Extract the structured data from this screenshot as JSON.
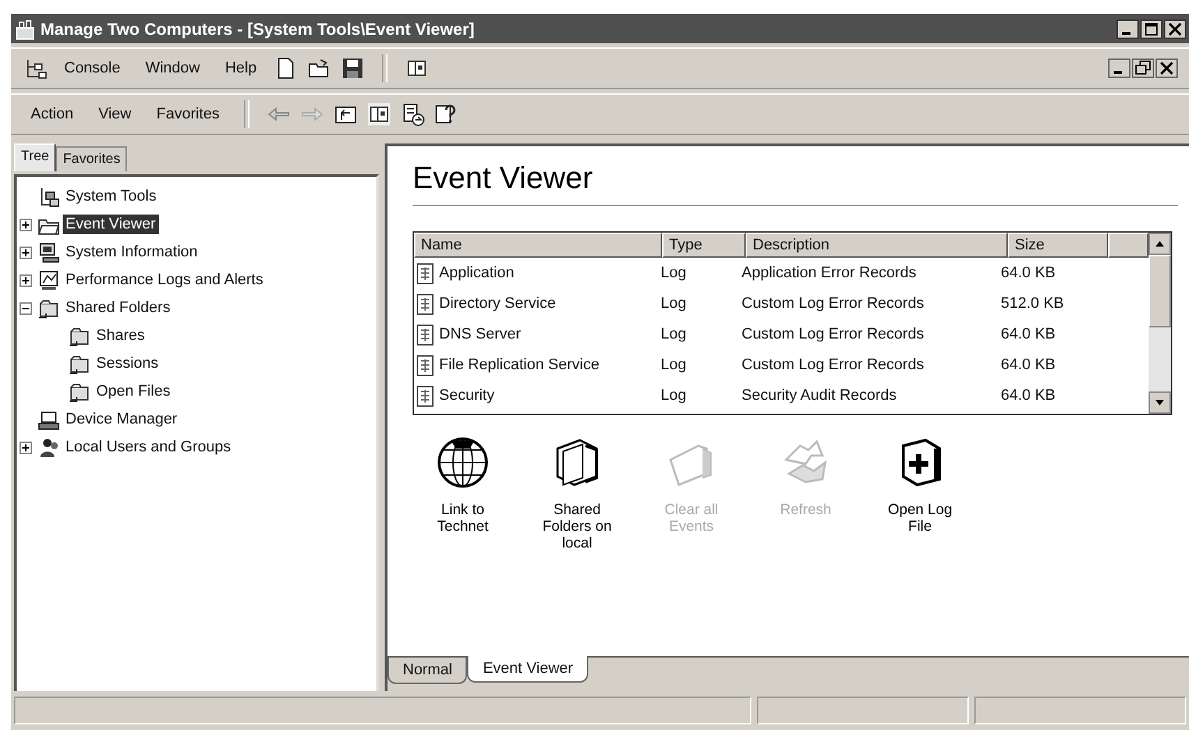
{
  "window": {
    "title": "Manage Two Computers - [System Tools\\Event Viewer]"
  },
  "menu_bar": {
    "items": [
      "Console",
      "Window",
      "Help"
    ]
  },
  "action_bar": {
    "items": [
      "Action",
      "View",
      "Favorites"
    ]
  },
  "left_tabs": [
    {
      "label": "Tree",
      "selected": true
    },
    {
      "label": "Favorites",
      "selected": false
    }
  ],
  "tree": [
    {
      "label": "System Tools",
      "kind": "tools",
      "selected": false,
      "children": [
        {
          "label": "Event Viewer",
          "kind": "viewer",
          "selected": true,
          "expanded": false
        },
        {
          "label": "System Information",
          "kind": "computer",
          "selected": false,
          "expanded": false
        },
        {
          "label": "Performance Logs and Alerts",
          "kind": "monitor",
          "selected": false,
          "expanded": false
        },
        {
          "label": "Shared Folders",
          "kind": "share",
          "selected": false,
          "expanded": true,
          "children": [
            {
              "label": "Shares",
              "kind": "share",
              "selected": false
            },
            {
              "label": "Sessions",
              "kind": "share",
              "selected": false
            },
            {
              "label": "Open Files",
              "kind": "share",
              "selected": false
            }
          ]
        },
        {
          "label": "Device Manager",
          "kind": "device",
          "selected": false
        },
        {
          "label": "Local Users and Groups",
          "kind": "users",
          "selected": false,
          "expanded": false
        }
      ]
    }
  ],
  "heading": "Event Viewer",
  "table": {
    "columns": [
      "Name",
      "Type",
      "Description",
      "Size"
    ],
    "rows": [
      [
        "Application",
        "Log",
        "Application Error Records",
        "64.0 KB"
      ],
      [
        "Directory Service",
        "Log",
        "Custom Log Error Records",
        "512.0 KB"
      ],
      [
        "DNS Server",
        "Log",
        "Custom Log Error Records",
        "64.0 KB"
      ],
      [
        "File Replication Service",
        "Log",
        "Custom Log Error Records",
        "64.0 KB"
      ],
      [
        "Security",
        "Log",
        "Security Audit Records",
        "64.0 KB"
      ]
    ]
  },
  "tasks": [
    {
      "label": "Link to Technet",
      "kind": "globe",
      "disabled": false
    },
    {
      "label": "Shared Folders on local",
      "kind": "folders",
      "disabled": false
    },
    {
      "label": "Clear all Events",
      "kind": "clear",
      "disabled": true
    },
    {
      "label": "Refresh",
      "kind": "refresh",
      "disabled": true
    },
    {
      "label": "Open Log File",
      "kind": "open",
      "disabled": false
    }
  ],
  "view_tabs": [
    {
      "label": "Normal",
      "selected": false
    },
    {
      "label": "Event Viewer",
      "selected": true
    }
  ]
}
